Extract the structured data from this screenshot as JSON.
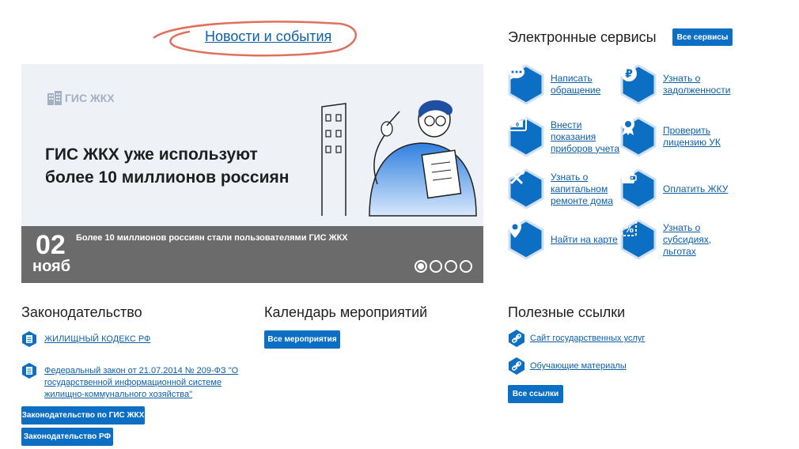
{
  "news": {
    "title": "Новости и события"
  },
  "banner": {
    "logo_text": "ГИС ЖКХ",
    "heading_line1": "ГИС ЖКХ уже используют",
    "heading_line2": "более 10 миллионов россиян",
    "date_day": "02",
    "date_month": "нояб",
    "caption": "Более 10 миллионов россиян стали пользователями ГИС ЖКХ",
    "slides_total": 4,
    "active_slide": 1
  },
  "services": {
    "title": "Электронные сервисы",
    "all_button": "Все сервисы",
    "items": [
      {
        "label": "Написать обращение",
        "icon": "chat-icon"
      },
      {
        "label": "Узнать о задолженности",
        "icon": "ruble-icon"
      },
      {
        "label": "Внести показания приборов учета",
        "icon": "meter-icon"
      },
      {
        "label": "Проверить лицензию УК",
        "icon": "license-icon"
      },
      {
        "label": "Узнать о капитальном ремонте дома",
        "icon": "tools-icon"
      },
      {
        "label": "Оплатить ЖКУ",
        "icon": "wallet-icon"
      },
      {
        "label": "Найти на карте",
        "icon": "map-pin-icon"
      },
      {
        "label": "Узнать о субсидиях, льготах",
        "icon": "percent-icon"
      }
    ]
  },
  "legislation": {
    "title": "Законодательство",
    "items": [
      "ЖИЛИЩНЫЙ КОДЕКС РФ",
      "Федеральный закон от 21.07.2014 № 209-ФЗ \"О государственной информационной системе жилищно-коммунального хозяйства\""
    ],
    "button_gis": "Законодательство по ГИС ЖКХ",
    "button_rf": "Законодательство РФ"
  },
  "calendar": {
    "title": "Календарь мероприятий",
    "button": "Все мероприятия"
  },
  "links": {
    "title": "Полезные ссылки",
    "items": [
      "Сайт государственных услуг",
      "Обучающие материалы"
    ],
    "button": "Все ссылки"
  },
  "colors": {
    "brand_blue": "#0d6fc4",
    "link_blue": "#0d5fa8",
    "caption_gray": "#6b6b6b",
    "highlight_red": "#e0705c"
  }
}
